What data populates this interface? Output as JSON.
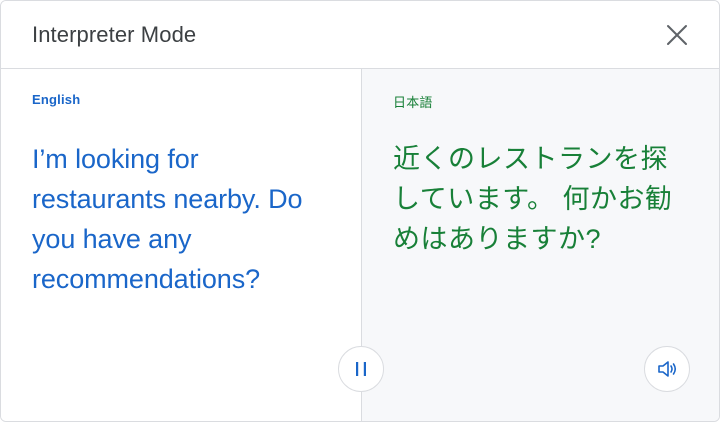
{
  "header": {
    "title": "Interpreter Mode",
    "close_icon": "close-icon"
  },
  "source": {
    "language": "English",
    "text": "I’m looking for restaurants nearby. Do you have any recommendations?",
    "color": "#1a66c9"
  },
  "target": {
    "language": "日本語",
    "text": "近くのレストランを探しています。 何かお勧めはありますか?",
    "color": "#188038"
  },
  "controls": {
    "pause_icon": "pause-icon",
    "speaker_icon": "speaker-icon"
  }
}
